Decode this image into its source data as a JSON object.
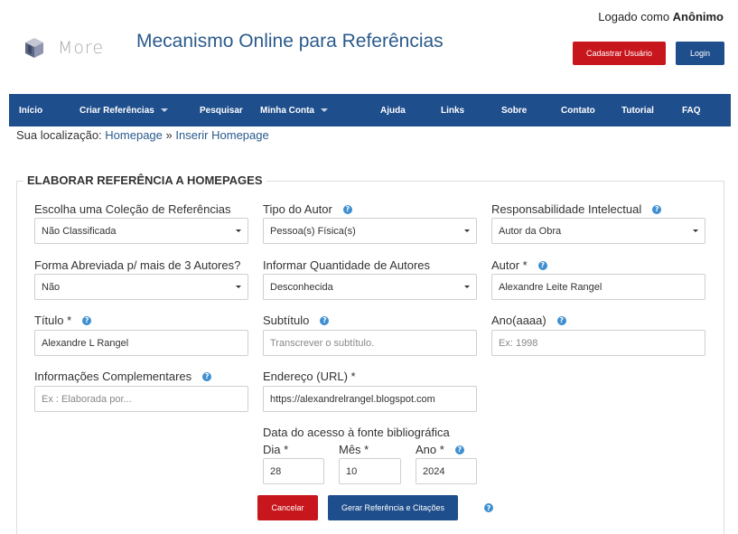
{
  "header": {
    "logged_prefix": "Logado como",
    "logged_user": "Anônimo",
    "logo_word": "More",
    "title": "Mecanismo Online para Referências",
    "register_button": "Cadastrar Usuário",
    "login_button": "Login"
  },
  "nav": {
    "items": [
      "Início",
      "Criar Referências",
      "Pesquisar",
      "Minha Conta",
      "Ajuda",
      "Links",
      "Sobre",
      "Contato",
      "Tutorial",
      "FAQ"
    ]
  },
  "breadcrumb": {
    "prefix": "Sua localização:",
    "home": "Homepage",
    "sep": "»",
    "current": "Inserir Homepage"
  },
  "form": {
    "legend": "ELABORAR REFERÊNCIA A HOMEPAGES",
    "collection": {
      "label": "Escolha uma Coleção de Referências",
      "value": "Não Classificada"
    },
    "author_type": {
      "label": "Tipo do Autor",
      "value": "Pessoa(s) Física(s)"
    },
    "responsibility": {
      "label": "Responsabilidade Intelectual",
      "value": "Autor da Obra"
    },
    "abbrev": {
      "label": "Forma Abreviada p/ mais de 3 Autores?",
      "value": "Não"
    },
    "author_qty": {
      "label": "Informar Quantidade de Autores",
      "value": "Desconhecida"
    },
    "author": {
      "label": "Autor *",
      "value": "Alexandre Leite Rangel"
    },
    "title": {
      "label": "Título *",
      "value": "Alexandre L Rangel"
    },
    "subtitle": {
      "label": "Subtítulo",
      "placeholder": "Transcrever o subtítulo."
    },
    "year": {
      "label": "Ano(aaaa)",
      "placeholder": "Ex: 1998"
    },
    "complement": {
      "label": "Informações Complementares",
      "placeholder": "Ex : Elaborada por..."
    },
    "url": {
      "label": "Endereço (URL) *",
      "value": "https://alexandrelrangel.blogspot.com"
    },
    "access_date": {
      "label": "Data do acesso à fonte bibliográfica",
      "day_label": "Dia *",
      "day": "28",
      "month_label": "Mês *",
      "month": "10",
      "year_label": "Ano *",
      "year": "2024"
    },
    "cancel_button": "Cancelar",
    "generate_button": "Gerar Referência e Citações",
    "help_glyph": "?"
  },
  "colors": {
    "brand_blue": "#1f4e8c",
    "danger_red": "#c8161d",
    "help_blue": "#3d8fd1",
    "title_blue": "#2a5a8c"
  }
}
